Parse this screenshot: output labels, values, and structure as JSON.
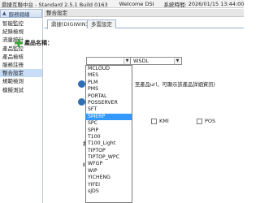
{
  "topbar": {
    "title": "鼎捷互聯中台 - Standard 2.5.1 Build 0163",
    "welcome": "Welcome DSI",
    "systime_label": "系統時間:",
    "systime": "2026/01/15 13:44:00"
  },
  "left_panel": {
    "header": "服務總線",
    "items": [
      {
        "label": "智能監控",
        "active": false
      },
      {
        "label": "紀錄檢視",
        "active": false
      },
      {
        "label": "流量統計",
        "active": false
      },
      {
        "label": "產品監控",
        "active": false
      },
      {
        "label": "產品檢核",
        "active": false
      },
      {
        "label": "服務註冊",
        "active": false
      },
      {
        "label": "整合設定",
        "active": true
      },
      {
        "label": "規範檢測",
        "active": false
      },
      {
        "label": "模擬測試",
        "active": false
      }
    ],
    "bottom_header": "資料轉換管理",
    "bottom_item": "Job管理"
  },
  "main": {
    "header": "整合設定",
    "tabs": [
      {
        "label": "鼎捷(DIGIWIN)",
        "active": true
      },
      {
        "label": "多雲設定",
        "active": false
      }
    ],
    "product_name_label": "產品名稱：",
    "interface_select": "WSDL",
    "product_options": [
      "MCLOUD",
      "MES",
      "PLM",
      "PMS",
      "PORTAL",
      "POSSERVER",
      "SFT",
      "SMERP",
      "SPC",
      "SPIP",
      "T100",
      "T100_Light",
      "TIPTOP",
      "TIPTOP_WPC",
      "WFGP",
      "WIP",
      "YICHENG",
      "YIFEI",
      "sJDS"
    ],
    "highlighted_option": "SMERP",
    "hint_text": "至產品url，可顯示該產品詳細資訊)",
    "checkboxes": [
      {
        "label": "KMI",
        "checked": false
      },
      {
        "label": "POS",
        "checked": false
      }
    ],
    "edge_label_a": "共",
    "edge_label_b": "I"
  },
  "colors": {
    "highlight": "#3399ff",
    "nav_active": "#c7dcf5",
    "panel_header": "#d4dfee",
    "plus_icon": "#3aa53a"
  }
}
